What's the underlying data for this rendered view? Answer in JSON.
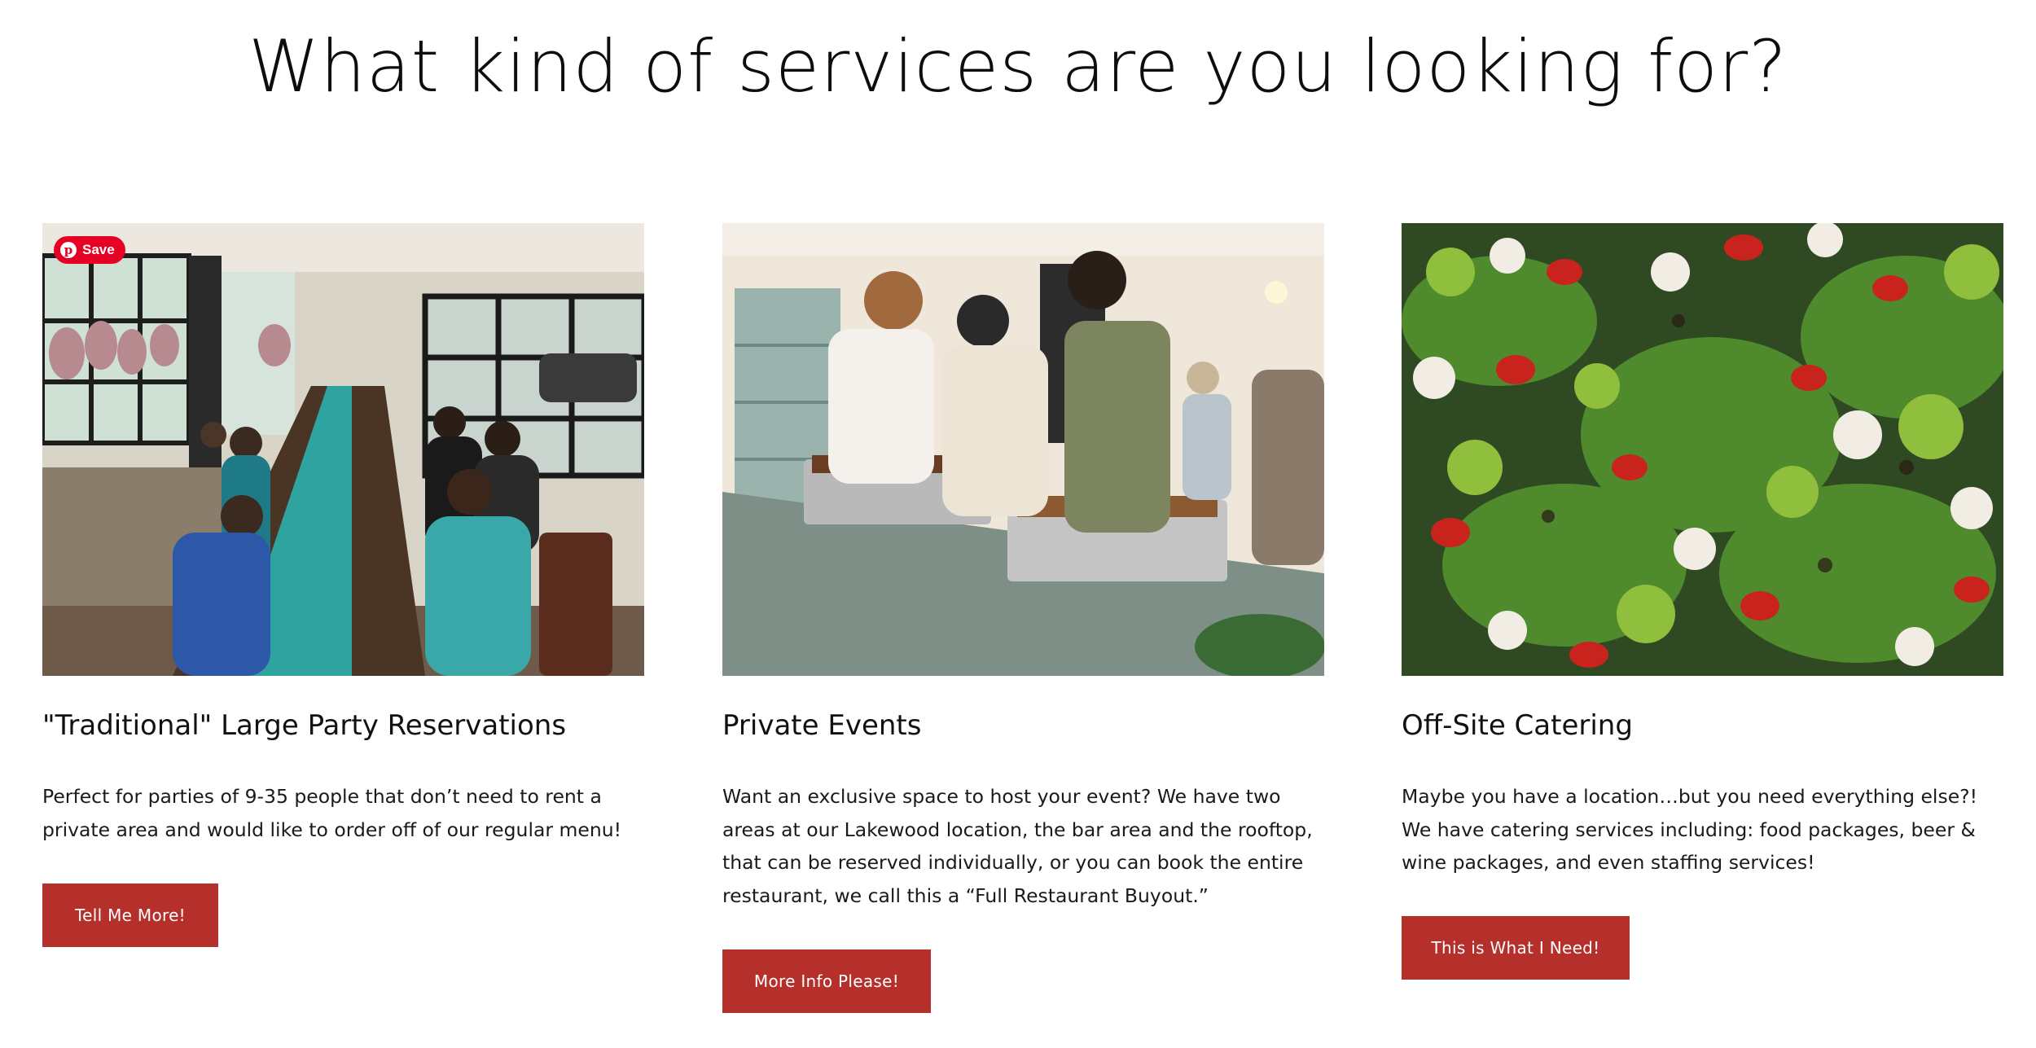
{
  "heading": "What kind of services are you looking for?",
  "pinterest": {
    "save_label": "Save",
    "icon": "pinterest-icon"
  },
  "services": [
    {
      "image_description": "Large group of guests seated at a long table with teal runner and balloons in a bright windowed dining room",
      "title": "\"Traditional\" Large Party Reservations",
      "description": "Perfect for parties of 9-35 people that don’t need to rent a private area and would like to order off of our regular menu!",
      "button_label": "Tell Me More!"
    },
    {
      "image_description": "Guests serving themselves from chafing dishes at a buffet table during a private event",
      "title": "Private Events",
      "description": "Want an exclusive space to host your event? We have two areas at our Lakewood location, the bar area and the rooftop, that can be reserved individually, or you can book the entire restaurant, we call this a “Full Restaurant Buyout.”",
      "button_label": "More Info Please!"
    },
    {
      "image_description": "Close-up of catering platter with greens, cherry tomatoes, cauliflower and broccoli skewers",
      "title": "Off-Site Catering",
      "description": "Maybe you have a location…but you need everything else?! We have catering services including: food packages, beer & wine packages, and even staffing services!",
      "button_label": "This is What I Need!"
    }
  ],
  "colors": {
    "button_bg": "#b5302a",
    "button_text": "#ffffff",
    "pinterest_red": "#e60023"
  }
}
